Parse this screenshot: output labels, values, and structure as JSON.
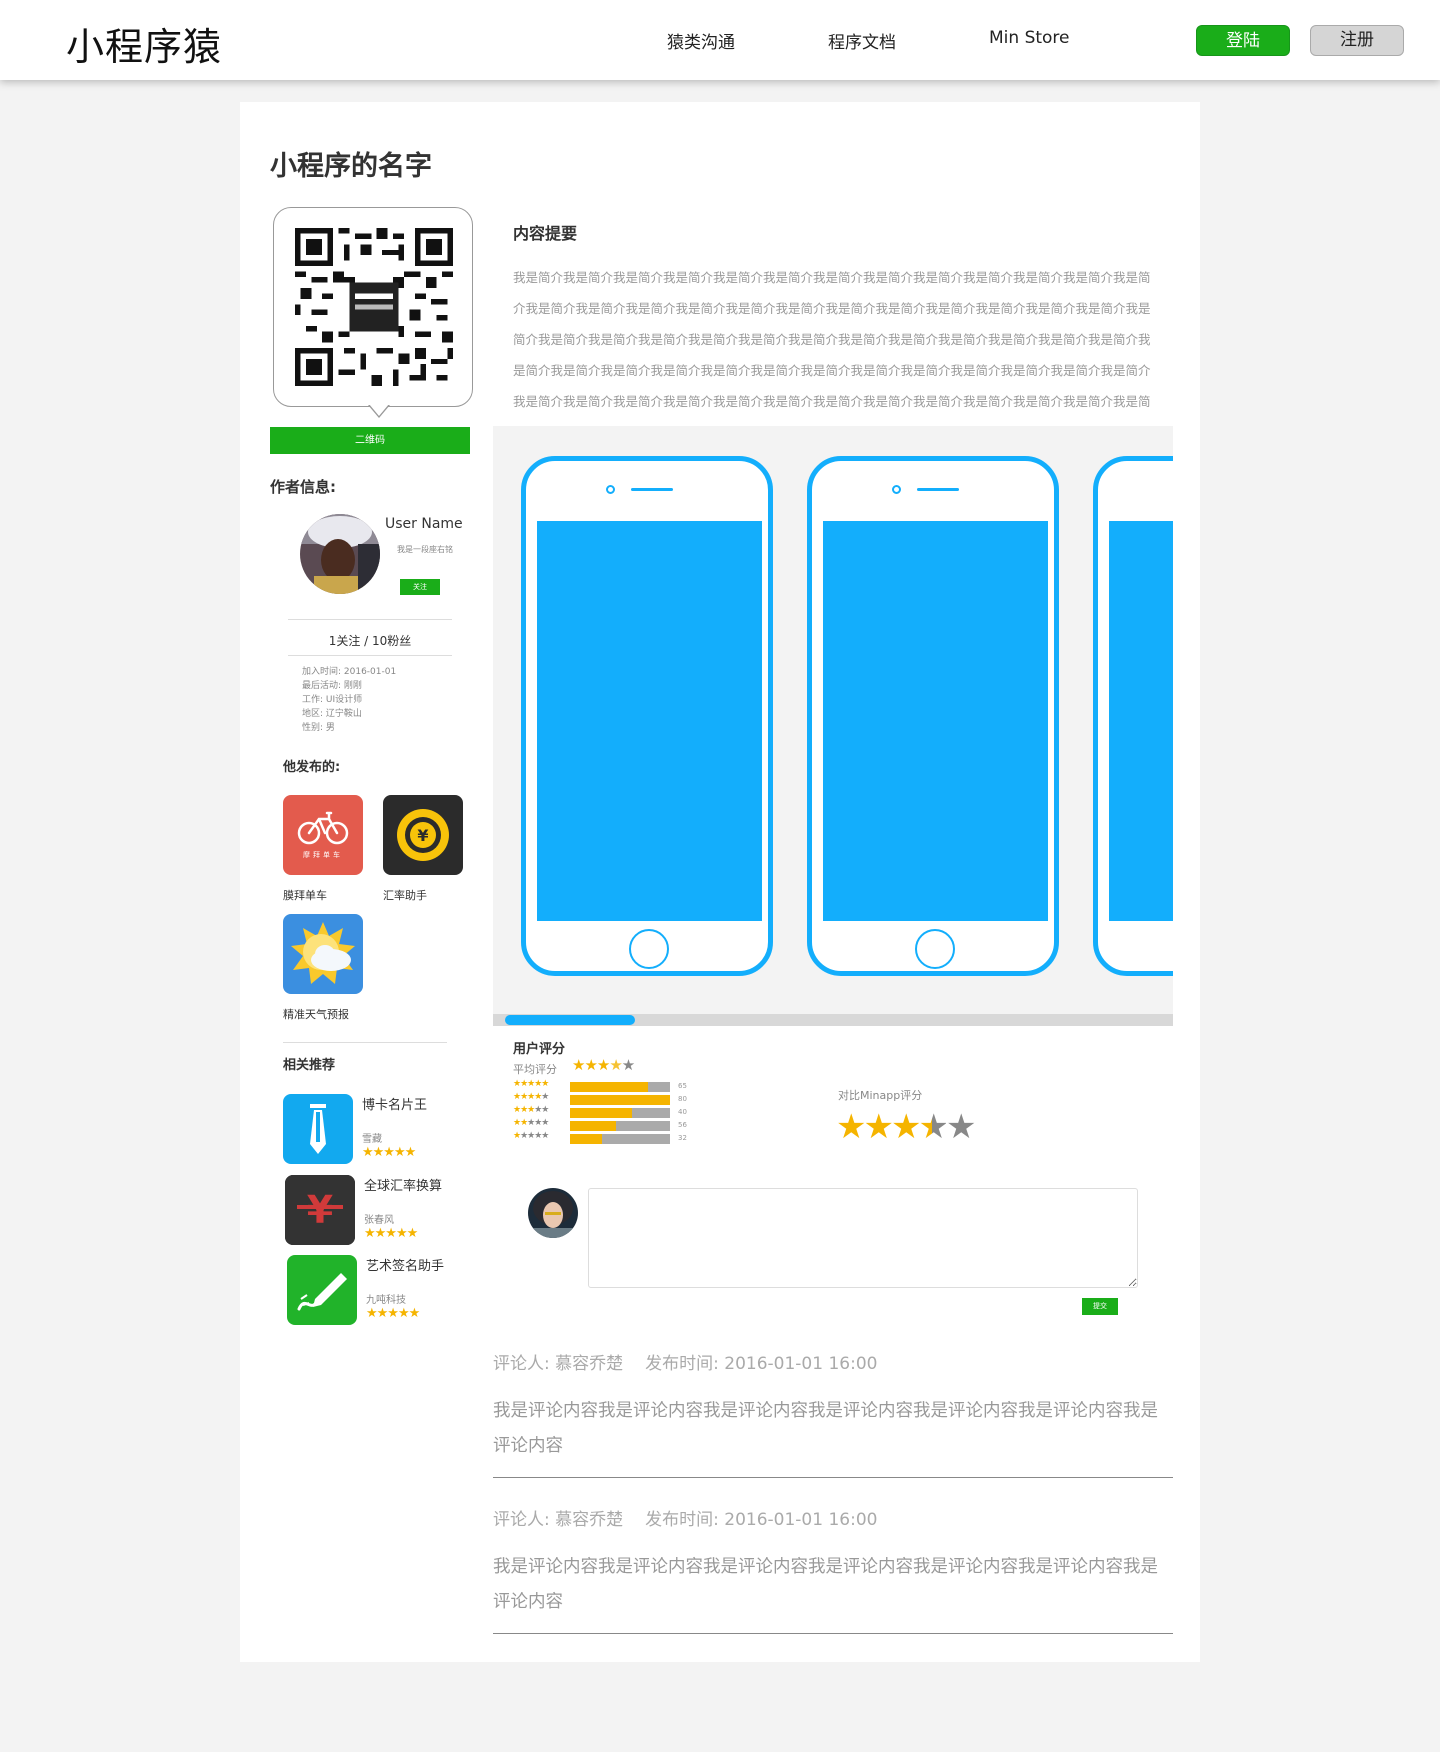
{
  "header": {
    "logo": "小程序猿",
    "nav": [
      "猿类沟通",
      "程序文档",
      "Min Store"
    ],
    "login": "登陆",
    "register": "注册"
  },
  "app": {
    "title": "小程序的名字",
    "qr_button": "二维码",
    "summary_heading": "内容提要",
    "summary": "我是简介我是简介我是简介我是简介我是简介我是简介我是简介我是简介我是简介我是简介我是简介我是简介我是简介我是简介我是简介我是简介我是简介我是简介我是简介我是简介我是简介我是简介我是简介我是简介我是简介我是简介我是简介我是简介我是简介我是简介我是简介我是简介我是简介我是简介我是简介我是简介我是简介我是简介我是简介我是简介我是简介我是简介我是简介我是简介我是简介我是简介我是简介我是简介我是简介我是简介我是简介我是简介我是简介我是简介我是简介我是简介我是简介我是简介我是简介我是简介我是简介我是简介我是简介我是简介我是简介我是简介我是简介我是简介我是简介我是简介我是简介我是简介我是简介我是简介我是简介"
  },
  "author": {
    "heading": "作者信息:",
    "name": "User Name",
    "signature": "我是一段座右铭",
    "follow_button": "关注",
    "stats": "1关注 / 10粉丝",
    "info": [
      "加入时间: 2016-01-01",
      "最后活动: 刚刚",
      "工作: UI设计师",
      "地区: 辽宁鞍山",
      "性别: 男"
    ]
  },
  "published": {
    "heading": "他发布的:",
    "items": [
      {
        "name": "膜拜单车",
        "icon": "bike-icon",
        "color": "#e35b4d"
      },
      {
        "name": "汇率助手",
        "icon": "yen-coin-icon",
        "color": "#2b2b2b"
      },
      {
        "name": "精准天气预报",
        "icon": "weather-icon",
        "color": "#3b8fe0"
      }
    ]
  },
  "recommend": {
    "heading": "相关推荐",
    "items": [
      {
        "name": "博卡名片王",
        "author": "雪藏",
        "rating": 5,
        "icon": "tie-icon",
        "color": "#12a9ef"
      },
      {
        "name": "全球汇率换算",
        "author": "张春风",
        "rating": 5,
        "icon": "currency-icon",
        "color": "#333333"
      },
      {
        "name": "艺术签名助手",
        "author": "九吨科技",
        "rating": 5,
        "icon": "pen-icon",
        "color": "#21b32a"
      }
    ]
  },
  "rating": {
    "heading": "用户评分",
    "avg_label": "平均评分",
    "avg_stars": 3.5,
    "distribution": [
      {
        "stars": 5,
        "count": 65,
        "fraction": 0.78
      },
      {
        "stars": 4,
        "count": 80,
        "fraction": 1.0
      },
      {
        "stars": 3,
        "count": 40,
        "fraction": 0.62
      },
      {
        "stars": 2,
        "count": 56,
        "fraction": 0.46
      },
      {
        "stars": 1,
        "count": 32,
        "fraction": 0.32
      }
    ],
    "compare_label": "对比Minapp评分",
    "compare_stars": 3.5
  },
  "comment": {
    "submit": "提交"
  },
  "reviews": [
    {
      "reviewer": "评论人: 慕容乔楚",
      "time": "发布时间: 2016-01-01 16:00",
      "body": "我是评论内容我是评论内容我是评论内容我是评论内容我是评论内容我是评论内容我是评论内容"
    },
    {
      "reviewer": "评论人: 慕容乔楚",
      "time": "发布时间: 2016-01-01 16:00",
      "body": "我是评论内容我是评论内容我是评论内容我是评论内容我是评论内容我是评论内容我是评论内容"
    }
  ],
  "colors": {
    "brand_green": "#1aad19",
    "accent_blue": "#13aefc",
    "star_gold": "#f5b400"
  }
}
